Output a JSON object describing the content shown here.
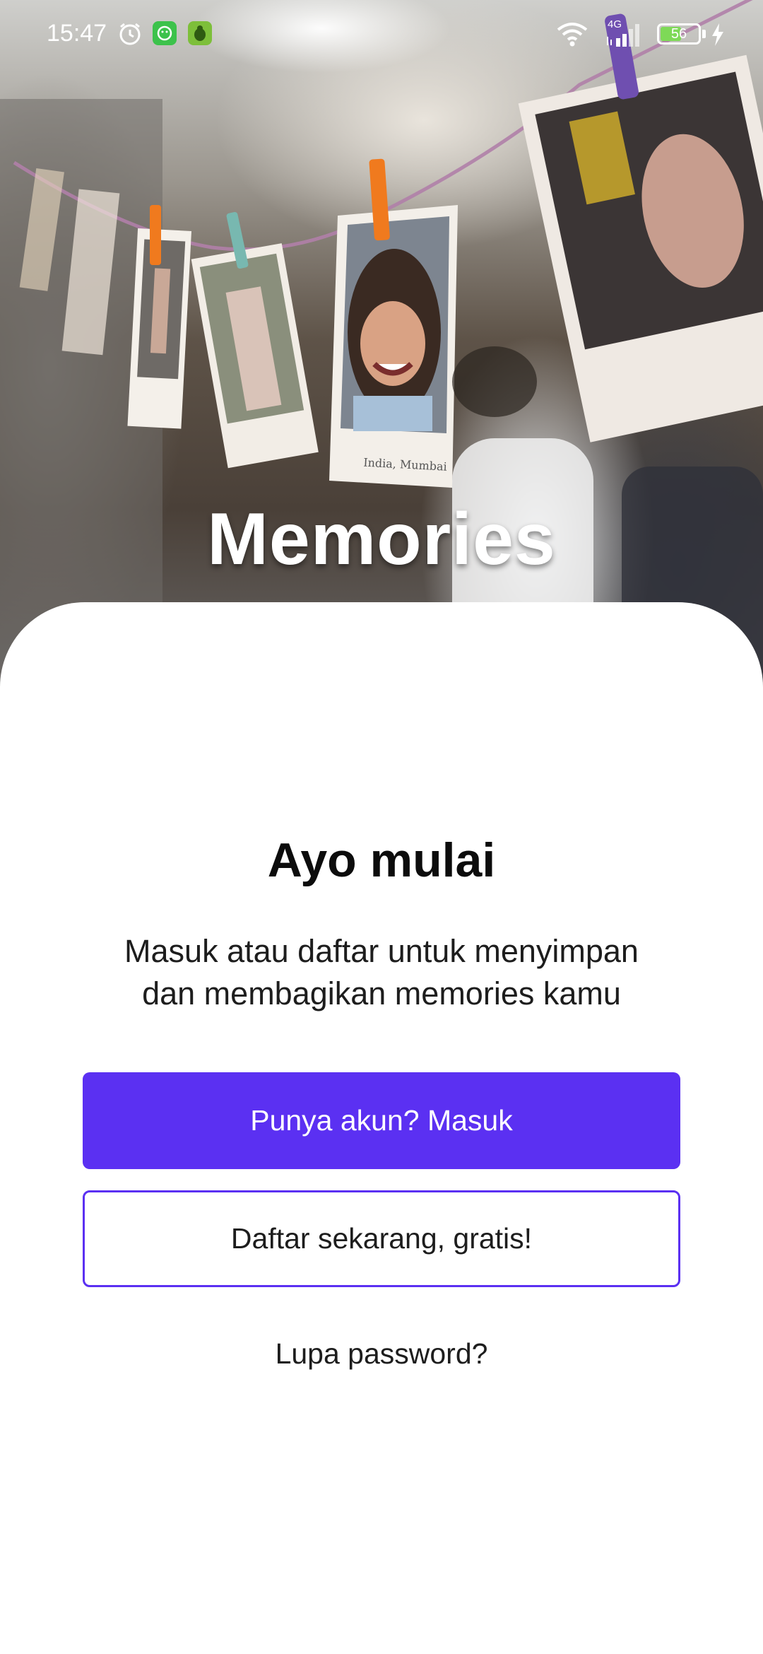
{
  "status_bar": {
    "time": "15:47",
    "battery_level": "56",
    "battery_fraction": 0.56,
    "network": "4G",
    "icons": [
      "alarm-icon",
      "app-notification-icon",
      "bug-app-icon",
      "wifi-icon",
      "signal-icon",
      "battery-icon",
      "charging-icon"
    ]
  },
  "hero": {
    "title": "Memories",
    "photo_caption": "India, Mumbai"
  },
  "main": {
    "headline": "Ayo mulai",
    "subtitle_line1": "Masuk atau daftar untuk menyimpan",
    "subtitle_line2": "dan membagikan memories kamu",
    "login_button": "Punya akun? Masuk",
    "register_button": "Daftar sekarang, gratis!",
    "forgot_password": "Lupa password?"
  },
  "colors": {
    "primary": "#5b30f2",
    "text": "#1d1d1d",
    "background": "#ffffff"
  }
}
